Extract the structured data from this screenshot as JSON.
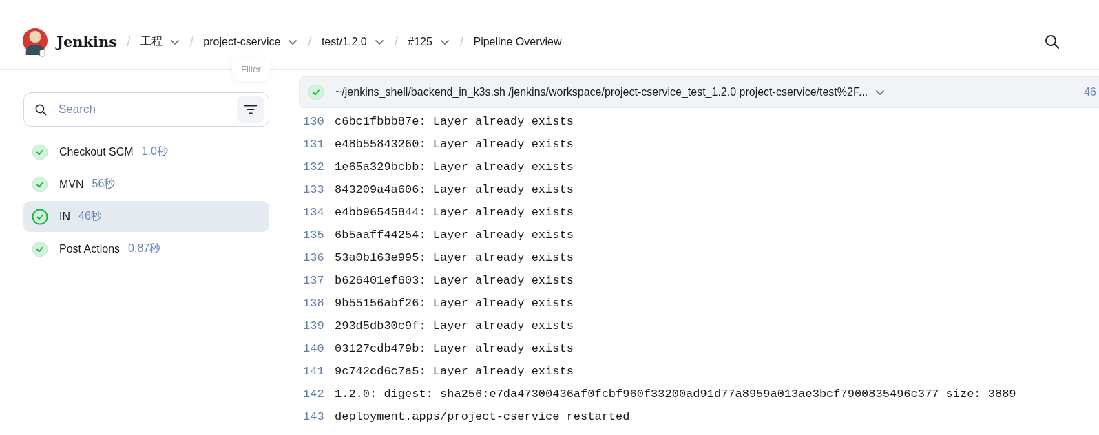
{
  "header": {
    "brand": "Jenkins",
    "breadcrumbs": [
      {
        "separator": "/",
        "label": "工程",
        "dropdown": true
      },
      {
        "separator": "/",
        "label": "project-cservice",
        "dropdown": true
      },
      {
        "separator": "/",
        "label": "test/1.2.0",
        "dropdown": true
      },
      {
        "separator": "/",
        "label": "#125",
        "dropdown": true
      },
      {
        "separator": "/",
        "label": "Pipeline Overview",
        "dropdown": false
      }
    ]
  },
  "tooltip": "Filter",
  "sidebar": {
    "search": {
      "placeholder": "Search"
    },
    "stages": [
      {
        "name": "Checkout SCM",
        "duration": "1.0秒",
        "selected": false
      },
      {
        "name": "MVN",
        "duration": "56秒",
        "selected": false
      },
      {
        "name": "IN",
        "duration": "46秒",
        "selected": true
      },
      {
        "name": "Post Actions",
        "duration": "0.87秒",
        "selected": false
      }
    ]
  },
  "log": {
    "step": {
      "command": "~/jenkins_shell/backend_in_k3s.sh /jenkins/workspace/project-cservice_test_1.2.0 project-cservice/test%2F...",
      "duration": "46"
    },
    "lines": [
      {
        "number": "130",
        "text": "c6bc1fbbb87e: Layer already exists"
      },
      {
        "number": "131",
        "text": "e48b55843260: Layer already exists"
      },
      {
        "number": "132",
        "text": "1e65a329bcbb: Layer already exists"
      },
      {
        "number": "133",
        "text": "843209a4a606: Layer already exists"
      },
      {
        "number": "134",
        "text": "e4bb96545844: Layer already exists"
      },
      {
        "number": "135",
        "text": "6b5aaff44254: Layer already exists"
      },
      {
        "number": "136",
        "text": "53a0b163e995: Layer already exists"
      },
      {
        "number": "137",
        "text": "b626401ef603: Layer already exists"
      },
      {
        "number": "138",
        "text": "9b55156abf26: Layer already exists"
      },
      {
        "number": "139",
        "text": "293d5db30c9f: Layer already exists"
      },
      {
        "number": "140",
        "text": "03127cdb479b: Layer already exists"
      },
      {
        "number": "141",
        "text": "9c742cd6c7a5: Layer already exists"
      },
      {
        "number": "142",
        "text": "1.2.0: digest: sha256:e7da47300436af0fcbf960f33200ad91d77a8959a013ae3bcf7900835496c377 size: 3889"
      },
      {
        "number": "143",
        "text": "deployment.apps/project-cservice restarted"
      }
    ]
  }
}
